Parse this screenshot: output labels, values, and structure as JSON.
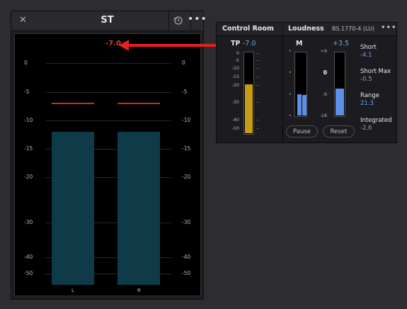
{
  "st_panel": {
    "title": "ST",
    "close_glyph": "✕",
    "more_glyph": "•••",
    "readout": "-7.0",
    "ticks_left": [
      "0",
      "-5",
      "-10",
      "-15",
      "-20",
      "-30",
      "-40",
      "-50"
    ],
    "ticks_right": [
      "0",
      "-5",
      "-10",
      "-15",
      "-20",
      "-30",
      "-40",
      "-50"
    ],
    "channels": [
      {
        "label": "L",
        "level_db": -12,
        "peak_db": -7
      },
      {
        "label": "R",
        "level_db": -12,
        "peak_db": -7
      }
    ],
    "bar_color": "#0f3b48",
    "peak_color": "#d42a1e",
    "readout_color": "#e23a2a"
  },
  "control_room": {
    "title": "Control Room",
    "tp_label": "TP",
    "tp_value": "-7.0",
    "tp_ticks_left": [
      "0",
      "-5",
      "-10",
      "-15",
      "-20",
      "-30",
      "-40",
      "-50"
    ],
    "tp_bar_color": "#c79a17",
    "tp_level_db": -20
  },
  "loudness": {
    "title": "Loudness",
    "standard": "BS.1770-4 (LU)",
    "more_glyph": "•••",
    "m_label": "M",
    "range_value": "+3.5",
    "scale_ticks": [
      "+9",
      "0",
      "-9",
      "-18"
    ],
    "m_ticks_left": [
      "•",
      "•",
      "•",
      "•"
    ],
    "bar_color": "#5d8fe6",
    "stats": [
      {
        "label": "Short",
        "value": "-4.1"
      },
      {
        "label": "Short Max",
        "value": "-0.5"
      },
      {
        "label": "Range",
        "value": "21.3"
      },
      {
        "label": "Integrated",
        "value": "-2.6"
      }
    ],
    "buttons": {
      "pause": "Pause",
      "reset": "Reset"
    }
  },
  "arrow_color": "#e8201a"
}
